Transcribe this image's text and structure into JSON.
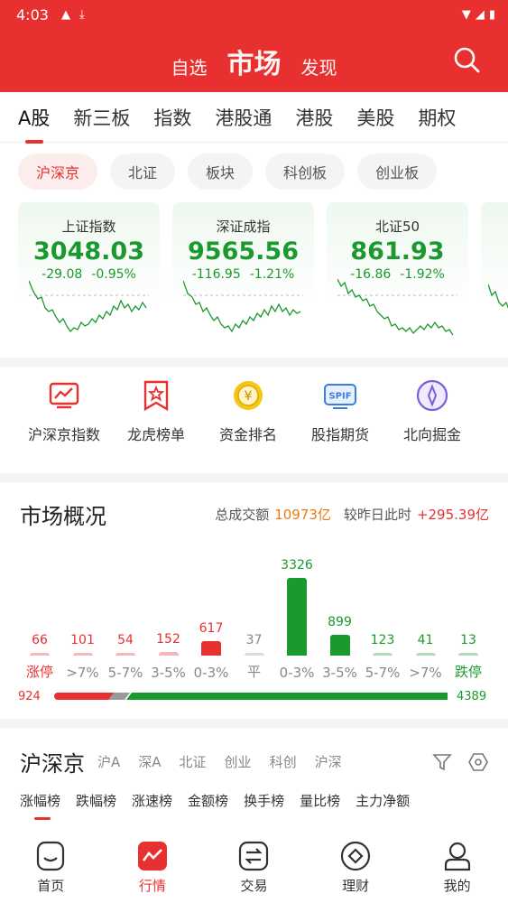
{
  "status": {
    "time": "4:03"
  },
  "header": {
    "tabs": [
      {
        "label": "自选"
      },
      {
        "label": "市场"
      },
      {
        "label": "发现"
      }
    ]
  },
  "market_tabs": [
    "A股",
    "新三板",
    "指数",
    "港股通",
    "港股",
    "美股",
    "期权"
  ],
  "chips": [
    "沪深京",
    "北证",
    "板块",
    "科创板",
    "创业板"
  ],
  "index_cards": [
    {
      "name": "上证指数",
      "value": "3048.03",
      "change": "-29.08",
      "pct": "-0.95%"
    },
    {
      "name": "深证成指",
      "value": "9565.56",
      "change": "-116.95",
      "pct": "-1.21%"
    },
    {
      "name": "北证50",
      "value": "861.93",
      "change": "-16.86",
      "pct": "-1.92%"
    }
  ],
  "quick_links": [
    {
      "label": "沪深京指数",
      "icon": "chart-icon"
    },
    {
      "label": "龙虎榜单",
      "icon": "badge-star-icon"
    },
    {
      "label": "资金排名",
      "icon": "yuan-coin-icon"
    },
    {
      "label": "股指期货",
      "icon": "spif-icon"
    },
    {
      "label": "北向掘金",
      "icon": "compass-icon"
    }
  ],
  "overview": {
    "title": "市场概况",
    "turnover_label": "总成交额",
    "turnover_value": "10973亿",
    "compare_label": "较昨日此时",
    "compare_value": "+295.39亿"
  },
  "distribution": [
    {
      "label": "涨停",
      "value": 66,
      "color": "#e93030"
    },
    {
      "label": ">7%",
      "value": 101,
      "color": "#e93030"
    },
    {
      "label": "5-7%",
      "value": 54,
      "color": "#e93030"
    },
    {
      "label": "3-5%",
      "value": 152,
      "color": "#e93030"
    },
    {
      "label": "0-3%",
      "value": 617,
      "color": "#e93030"
    },
    {
      "label": "平",
      "value": 37,
      "color": "#999999"
    },
    {
      "label": "0-3%",
      "value": 3326,
      "color": "#1a9a2e"
    },
    {
      "label": "3-5%",
      "value": 899,
      "color": "#1a9a2e"
    },
    {
      "label": "5-7%",
      "value": 123,
      "color": "#1a9a2e"
    },
    {
      "label": ">7%",
      "value": 41,
      "color": "#1a9a2e"
    },
    {
      "label": "跌停",
      "value": 13,
      "color": "#1a9a2e"
    }
  ],
  "ratio": {
    "up": "924",
    "down": "4389"
  },
  "list": {
    "title": "沪深京",
    "tabs": [
      "沪A",
      "深A",
      "北证",
      "创业",
      "科创",
      "沪深"
    ],
    "rank_tabs": [
      "涨幅榜",
      "跌幅榜",
      "涨速榜",
      "金额榜",
      "换手榜",
      "量比榜",
      "主力净额"
    ]
  },
  "bottom_nav": [
    {
      "label": "首页",
      "icon": "home-icon"
    },
    {
      "label": "行情",
      "icon": "market-icon"
    },
    {
      "label": "交易",
      "icon": "trade-icon"
    },
    {
      "label": "理财",
      "icon": "wealth-icon"
    },
    {
      "label": "我的",
      "icon": "profile-icon"
    }
  ],
  "colors": {
    "brand_red": "#e93030",
    "down_green": "#1a9a2e",
    "orange": "#e87a10"
  }
}
